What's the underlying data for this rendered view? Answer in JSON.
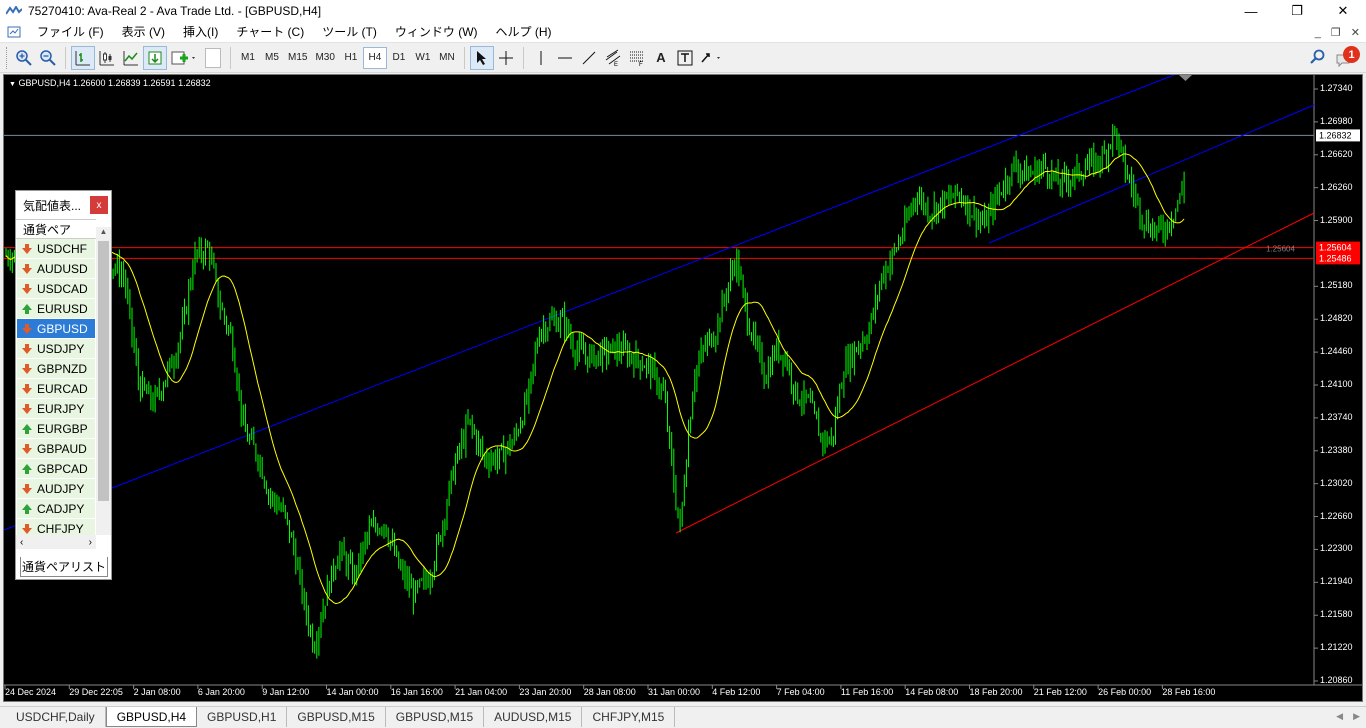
{
  "window": {
    "title": "75270410: Ava-Real 2 - Ava Trade Ltd. - [GBPUSD,H4]",
    "min": "—",
    "restore": "❐",
    "close": "✕"
  },
  "menu": {
    "items": [
      "ファイル (F)",
      "表示 (V)",
      "挿入(I)",
      "チャート (C)",
      "ツール (T)",
      "ウィンドウ (W)",
      "ヘルプ (H)"
    ],
    "right": [
      "_",
      "❐",
      "✕"
    ]
  },
  "toolbar": {
    "timeframes": [
      "M1",
      "M5",
      "M15",
      "M30",
      "H1",
      "H4",
      "D1",
      "W1",
      "MN"
    ],
    "active_timeframe": "H4",
    "notification_count": "1",
    "text_tool": "A"
  },
  "chart": {
    "info": "GBPUSD,H4  1.26600 1.26839 1.26591 1.26832",
    "current_price": "1.26832",
    "hline1": "1.25604",
    "hline2": "1.25486",
    "hline1_overlay": "1.25604",
    "price_labels": [
      "1.27340",
      "1.26980",
      "1.26620",
      "1.26260",
      "1.25900",
      "1.25180",
      "1.24820",
      "1.24460",
      "1.24100",
      "1.23740",
      "1.23380",
      "1.23020",
      "1.22660",
      "1.22300",
      "1.21940",
      "1.21580",
      "1.21220",
      "1.20860"
    ],
    "dates": [
      "24 Dec 2024",
      "29 Dec 22:05",
      "2 Jan 08:00",
      "6 Jan 20:00",
      "9 Jan 12:00",
      "14 Jan 00:00",
      "16 Jan 16:00",
      "21 Jan 04:00",
      "23 Jan 20:00",
      "28 Jan 08:00",
      "31 Jan 00:00",
      "4 Feb 12:00",
      "7 Feb 04:00",
      "11 Feb 16:00",
      "14 Feb 08:00",
      "18 Feb 20:00",
      "21 Feb 12:00",
      "26 Feb 00:00",
      "28 Feb 16:00"
    ],
    "colors": {
      "candle": "#00ff00",
      "ma": "#ffff00",
      "channel": "#0000ff",
      "support": "#ff0000"
    }
  },
  "market_watch": {
    "title": "気配値表...",
    "close": "x",
    "column": "通貨ペア",
    "symbols": [
      {
        "name": "USDCHF",
        "dir": "down"
      },
      {
        "name": "AUDUSD",
        "dir": "down"
      },
      {
        "name": "USDCAD",
        "dir": "down"
      },
      {
        "name": "EURUSD",
        "dir": "up"
      },
      {
        "name": "GBPUSD",
        "dir": "down"
      },
      {
        "name": "USDJPY",
        "dir": "down"
      },
      {
        "name": "GBPNZD",
        "dir": "down"
      },
      {
        "name": "EURCAD",
        "dir": "down"
      },
      {
        "name": "EURJPY",
        "dir": "down"
      },
      {
        "name": "EURGBP",
        "dir": "up"
      },
      {
        "name": "GBPAUD",
        "dir": "down"
      },
      {
        "name": "GBPCAD",
        "dir": "up"
      },
      {
        "name": "AUDJPY",
        "dir": "down"
      },
      {
        "name": "CADJPY",
        "dir": "up"
      },
      {
        "name": "CHFJPY",
        "dir": "down"
      }
    ],
    "selected": "GBPUSD",
    "tab": "通貨ペアリスト"
  },
  "tabs": [
    "USDCHF,Daily",
    "GBPUSD,H4",
    "GBPUSD,H1",
    "GBPUSD,M15",
    "GBPUSD,M15",
    "AUDUSD,M15",
    "CHFJPY,M15"
  ],
  "active_tab": "GBPUSD,H4"
}
